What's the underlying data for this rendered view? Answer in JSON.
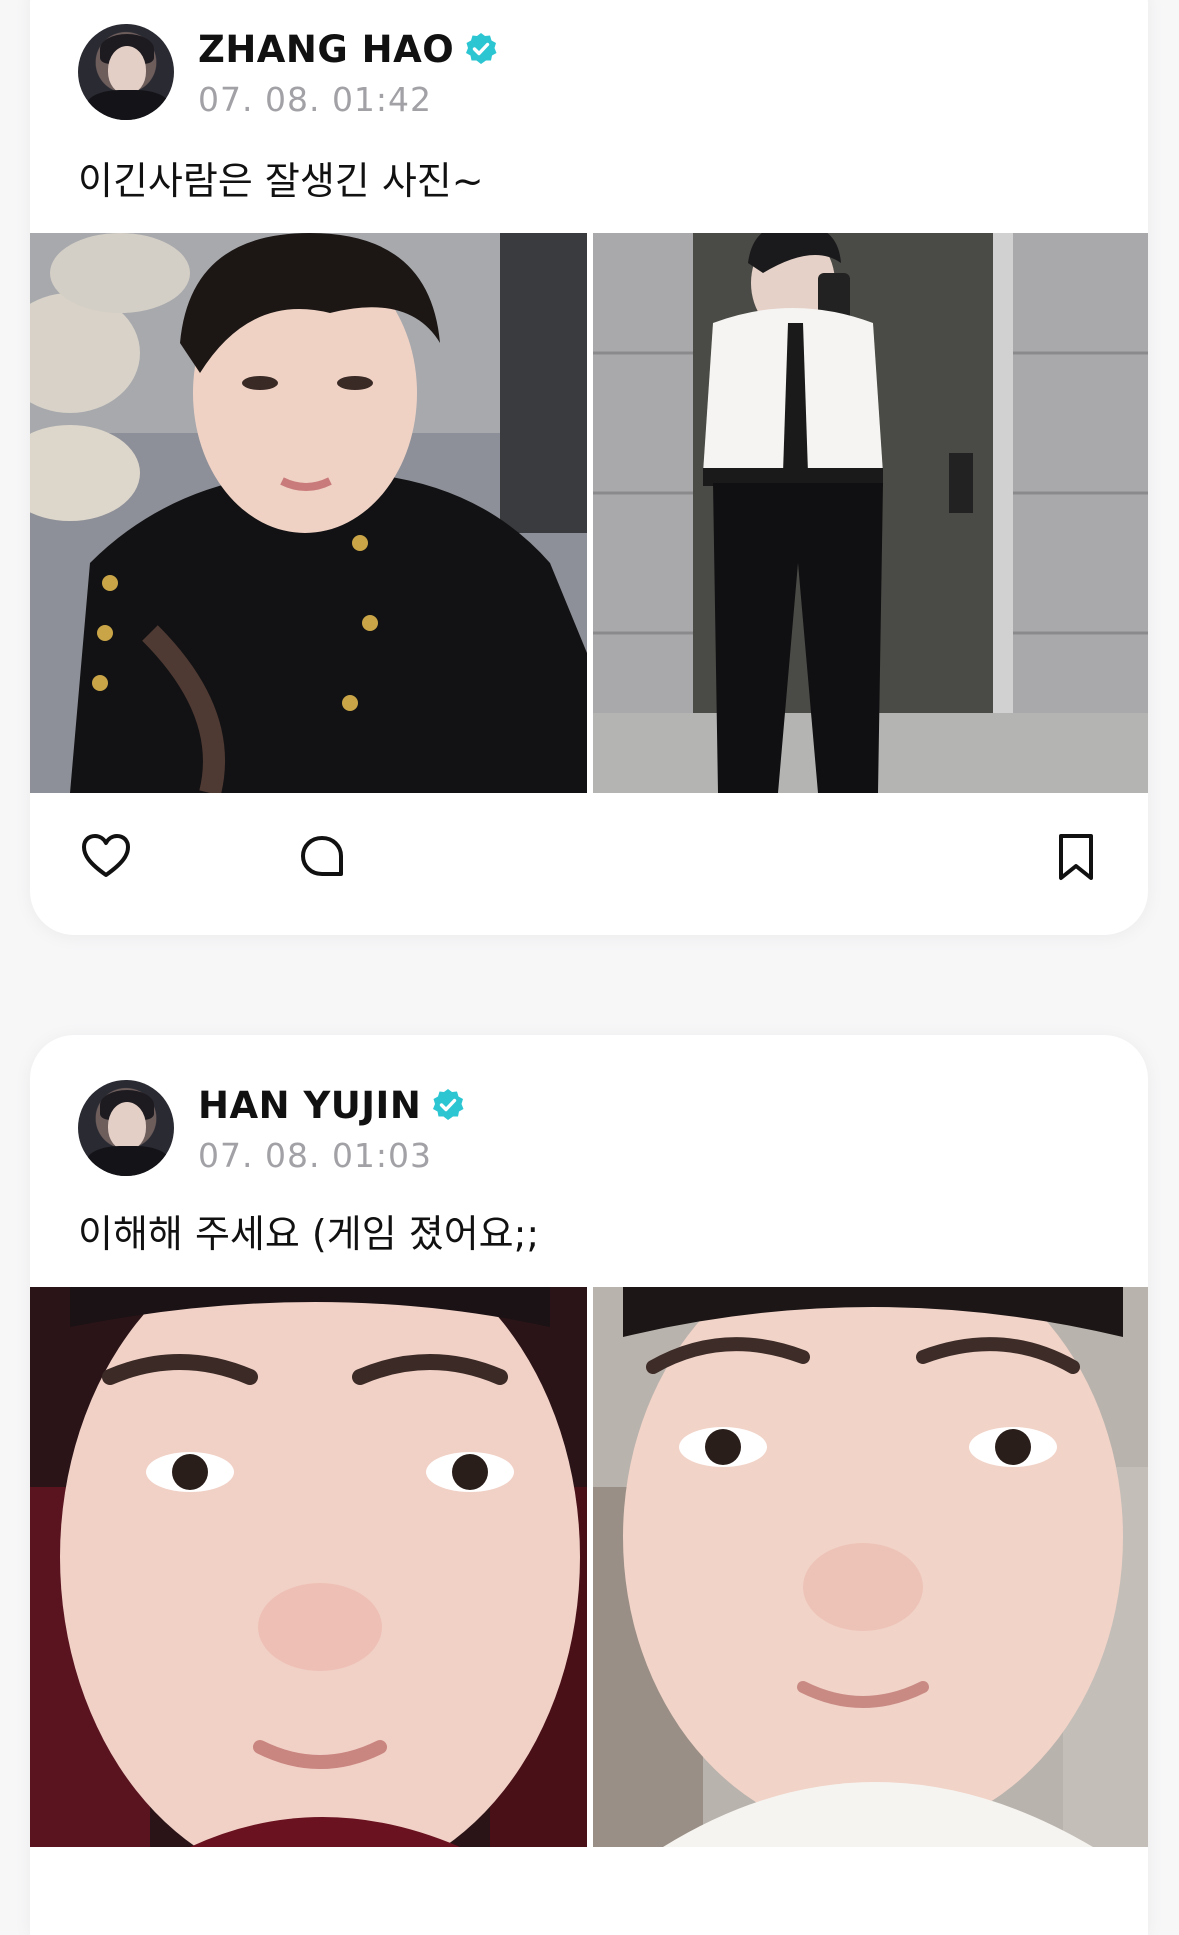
{
  "posts": [
    {
      "author": "ZHANG HAO",
      "verified": true,
      "timestamp": "07. 08. 01:42",
      "text": "이긴사람은 잘생긴 사진~",
      "images": [
        "selfie-black-jacket",
        "mirror-selfie-white-shirt-tie"
      ],
      "actions": [
        "heart-icon",
        "comment-icon",
        "bookmark-icon"
      ]
    },
    {
      "author": "HAN YUJIN",
      "verified": true,
      "timestamp": "07. 08. 01:03",
      "text": "이해해 주세요 (게임 졌어요;;",
      "images": [
        "closeup-face-dark-background",
        "closeup-face-room-background"
      ]
    }
  ],
  "colors": {
    "verified_badge": "#2cc5d2",
    "timestamp": "#a1a1a6",
    "text": "#111111",
    "card": "#ffffff",
    "background": "#f7f7f8"
  }
}
